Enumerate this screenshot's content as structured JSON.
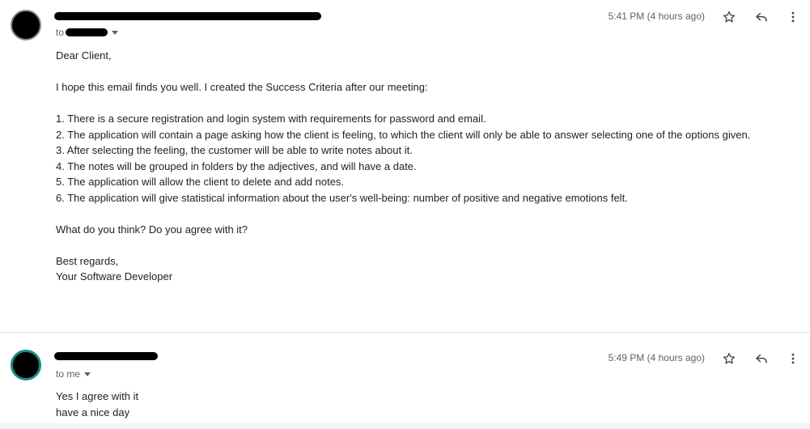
{
  "messages": [
    {
      "recipient_prefix": "to",
      "time": "5:41 PM (4 hours ago)",
      "body": {
        "greeting": "Dear Client,",
        "intro": "I hope this email finds you well. I created the Success Criteria after our meeting:",
        "criteria": [
          "1. There is a secure registration and login system with requirements for password and email.",
          "2. The application will contain a page asking how the client is feeling, to which the client will only be able to answer selecting one of the options given.",
          "3. After selecting the feeling, the customer will be able to write notes about it.",
          "4. The notes will be grouped in folders by the adjectives, and will have a date.",
          "5. The application will allow the client to delete and add notes.",
          "6. The application will give statistical information about the user's well-being: number of positive and negative emotions felt."
        ],
        "question": "What do you think? Do you agree with it?",
        "signoff": "Best regards,",
        "signature": "Your Software Developer"
      }
    },
    {
      "recipient_line": "to me",
      "time": "5:49 PM (4 hours ago)",
      "body": {
        "lines": [
          "Yes I agree with it",
          "have a nice day"
        ]
      }
    }
  ],
  "icons": {
    "star": "star-icon",
    "reply": "reply-icon",
    "more": "more-vert-icon",
    "dropdown": "chevron-down-icon"
  },
  "colors": {
    "avatar_fill": "#000000",
    "avatar_ring_1": "#8a8a8a",
    "avatar_ring_2": "#1a8a83",
    "meta_text": "#5f6368",
    "body_text": "#222222"
  }
}
